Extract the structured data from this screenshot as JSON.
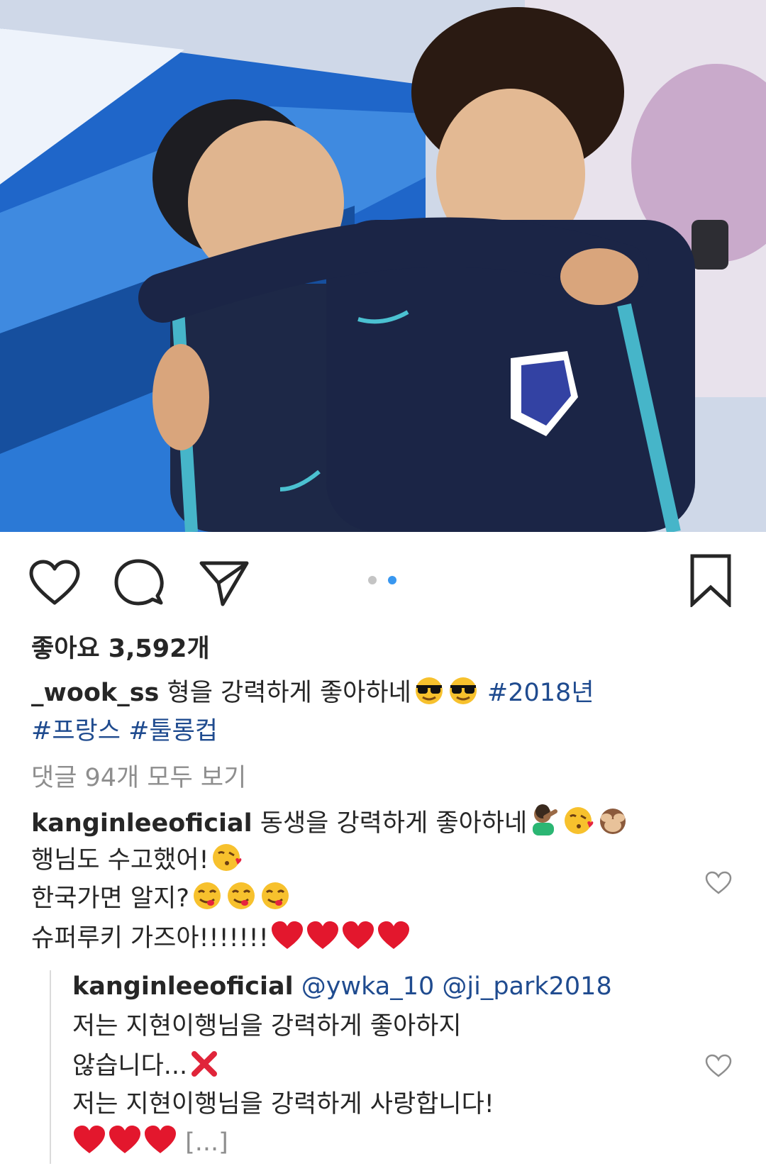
{
  "post": {
    "photo_alt": "",
    "likes": "좋아요 3,592개",
    "caption": {
      "user": "_wook_ss",
      "text": "형을 강력하게 좋아하네",
      "tags": [
        "#2018년",
        "#프랑스",
        "#툴롱컵"
      ]
    },
    "view_comments": "댓글 94개 모두 보기",
    "carousel": {
      "count": 2,
      "active": 2
    }
  },
  "comments": [
    {
      "user": "kanginleeoficial",
      "line1": "동생을 강력하게 좋아하네",
      "line2": "행님도 수고했어!",
      "line3": "한국가면 알지?",
      "line4": "슈퍼루키 가즈아!!!!!!!"
    }
  ],
  "reply": {
    "user": "kanginleeoficial",
    "mention1": "@ywka_10",
    "mention2": "@ji_park2018",
    "line1": "저는 지현이행님을 강력하게 좋아하지",
    "line2": "않습니다...",
    "line3": "저는 지현이행님을 강력하게 사랑합니다!",
    "more": "[...]"
  },
  "icons": {
    "like": "heart-icon",
    "comment": "comment-icon",
    "share": "share-icon",
    "save": "bookmark-icon",
    "comment_like": "heart-icon"
  },
  "colors": {
    "hashtag": "#1f4b8f",
    "active_dot": "#3897f0",
    "inactive_dot": "#c4c4c4",
    "text": "#262626",
    "muted": "#8e8e8e"
  }
}
